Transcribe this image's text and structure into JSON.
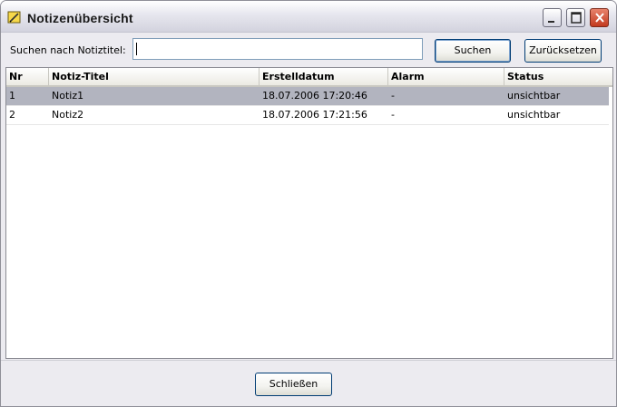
{
  "window": {
    "title": "Notizenübersicht"
  },
  "search": {
    "label": "Suchen nach Notiztitel:",
    "value": "",
    "button": "Suchen",
    "reset_button": "Zurücksetzen"
  },
  "table": {
    "columns": [
      "Nr",
      "Notiz-Titel",
      "Erstelldatum",
      "Alarm",
      "Status"
    ],
    "rows": [
      {
        "nr": "1",
        "title": "Notiz1",
        "created": "18.07.2006 17:20:46",
        "alarm": "-",
        "status": "unsichtbar",
        "selected": true
      },
      {
        "nr": "2",
        "title": "Notiz2",
        "created": "18.07.2006 17:21:56",
        "alarm": "-",
        "status": "unsichtbar",
        "selected": false
      }
    ]
  },
  "footer": {
    "close_button": "Schließen"
  },
  "icons": {
    "app": "note-icon",
    "minimize": "minimize-icon",
    "maximize": "maximize-icon",
    "close": "close-icon"
  }
}
